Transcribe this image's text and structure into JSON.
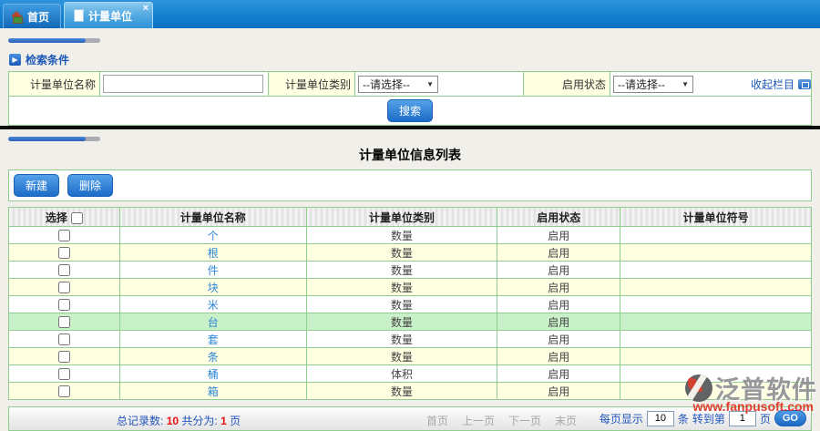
{
  "tabs": [
    {
      "label": "首页",
      "icon": "home-icon",
      "active": false
    },
    {
      "label": "计量单位",
      "icon": "document-icon",
      "active": true,
      "close_icon": "×"
    }
  ],
  "collapse_label": "收起栏目",
  "icons": {
    "play": "▶",
    "dropdown_arrow": "▼",
    "close": "×"
  },
  "search": {
    "section_title": "检索条件",
    "fields": [
      {
        "label": "计量单位名称",
        "type": "input",
        "value": ""
      },
      {
        "label": "计量单位类别",
        "type": "select",
        "value": "--请选择--"
      },
      {
        "label": "启用状态",
        "type": "select",
        "value": "--请选择--"
      }
    ],
    "search_button": "搜索"
  },
  "list": {
    "title": "计量单位信息列表",
    "new_button": "新建",
    "delete_button": "删除",
    "columns": [
      "选择",
      "计量单位名称",
      "计量单位类别",
      "启用状态",
      "计量单位符号"
    ],
    "rows": [
      {
        "name": "个",
        "category": "数量",
        "status": "启用",
        "symbol": "",
        "highlight": false
      },
      {
        "name": "根",
        "category": "数量",
        "status": "启用",
        "symbol": "",
        "highlight": false
      },
      {
        "name": "件",
        "category": "数量",
        "status": "启用",
        "symbol": "",
        "highlight": false
      },
      {
        "name": "块",
        "category": "数量",
        "status": "启用",
        "symbol": "",
        "highlight": false
      },
      {
        "name": "米",
        "category": "数量",
        "status": "启用",
        "symbol": "",
        "highlight": false
      },
      {
        "name": "台",
        "category": "数量",
        "status": "启用",
        "symbol": "",
        "highlight": true
      },
      {
        "name": "套",
        "category": "数量",
        "status": "启用",
        "symbol": "",
        "highlight": false
      },
      {
        "name": "条",
        "category": "数量",
        "status": "启用",
        "symbol": "",
        "highlight": false
      },
      {
        "name": "桶",
        "category": "体积",
        "status": "启用",
        "symbol": "",
        "highlight": false
      },
      {
        "name": "箱",
        "category": "数量",
        "status": "启用",
        "symbol": "",
        "highlight": false
      }
    ]
  },
  "pagination": {
    "total_label": "总记录数:",
    "total": "10",
    "pages_label": "共分为:",
    "pages": "1",
    "pages_unit": "页",
    "links": [
      "首页",
      "上一页",
      "下一页",
      "末页"
    ],
    "per_page_label": "每页显示",
    "per_page": "10",
    "per_page_unit": "条",
    "goto_label": "转到第",
    "goto_page": "1",
    "goto_unit": "页",
    "go_button": "GO"
  },
  "watermark": {
    "name": "泛普软件",
    "url": "www.fanpusoft.com"
  },
  "colors": {
    "tabbar_blue": "#1480d0",
    "active_tab_blue": "#56abe2",
    "panel_border_green": "#8fce8f",
    "row_alt_yellow": "#ffffe1",
    "row_highlight_green": "#c9f1c9",
    "link_blue": "#2f86d8",
    "button_blue": "#1b6cc8",
    "record_number_red": "#e81010",
    "label_text_blue": "#2255bb"
  }
}
